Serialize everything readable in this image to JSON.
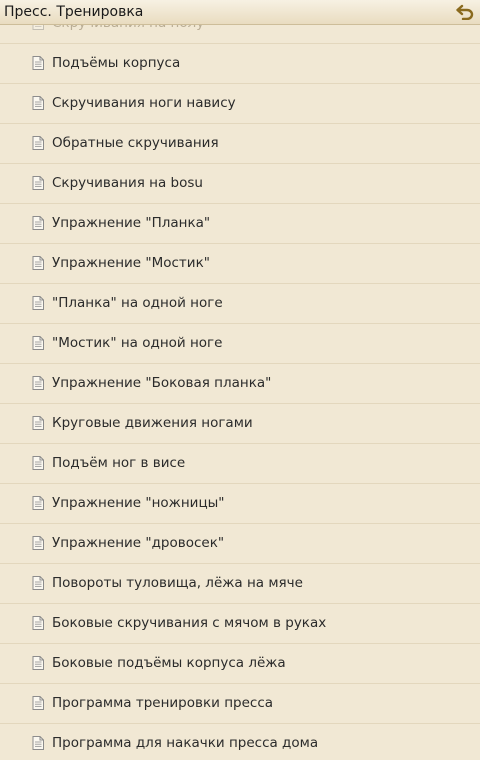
{
  "header": {
    "title": "Пресс. Тренировка",
    "back_icon": "undo-back-icon"
  },
  "list": {
    "items": [
      {
        "label": "Скручивания на полу",
        "icon": "document-icon"
      },
      {
        "label": "Подъёмы корпуса",
        "icon": "document-icon"
      },
      {
        "label": "Скручивания ноги навису",
        "icon": "document-icon"
      },
      {
        "label": "Обратные скручивания",
        "icon": "document-icon"
      },
      {
        "label": "Скручивания на bosu",
        "icon": "document-icon"
      },
      {
        "label": "Упражнение \"Планка\"",
        "icon": "document-icon"
      },
      {
        "label": "Упражнение \"Мостик\"",
        "icon": "document-icon"
      },
      {
        "label": "\"Планка\" на одной ноге",
        "icon": "document-icon"
      },
      {
        "label": "\"Мостик\" на одной ноге",
        "icon": "document-icon"
      },
      {
        "label": "Упражнение \"Боковая планка\"",
        "icon": "document-icon"
      },
      {
        "label": "Круговые движения ногами",
        "icon": "document-icon"
      },
      {
        "label": "Подъём ног в висе",
        "icon": "document-icon"
      },
      {
        "label": "Упражнение \"ножницы\"",
        "icon": "document-icon"
      },
      {
        "label": "Упражнение \"дровосек\"",
        "icon": "document-icon"
      },
      {
        "label": "Повороты туловища, лёжа на мяче",
        "icon": "document-icon"
      },
      {
        "label": "Боковые скручивания с мячом в руках",
        "icon": "document-icon"
      },
      {
        "label": "Боковые подъёмы корпуса лёжа",
        "icon": "document-icon"
      },
      {
        "label": "Программа тренировки пресса",
        "icon": "document-icon"
      },
      {
        "label": "Программа для накачки пресса дома",
        "icon": "document-icon"
      }
    ]
  },
  "colors": {
    "background": "#f1e8d4",
    "titlebar": "#ede2c9",
    "back_icon": "#8a6a1e",
    "divider": "#e3d7bd"
  }
}
